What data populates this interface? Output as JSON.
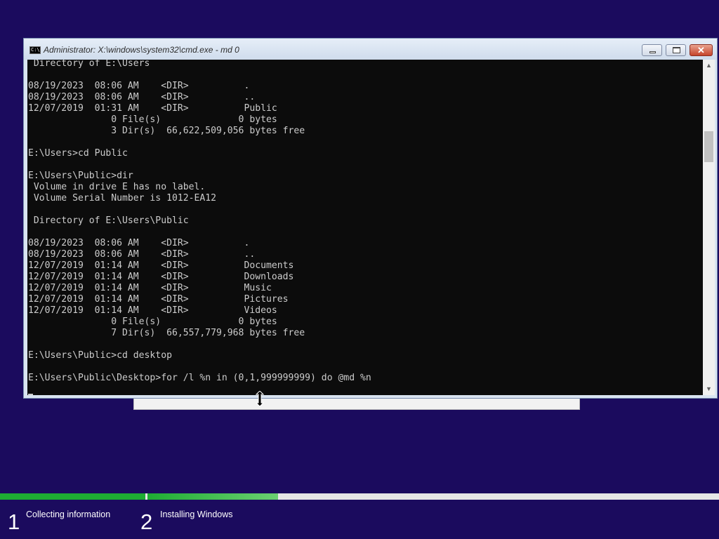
{
  "window": {
    "title": "Administrator: X:\\windows\\system32\\cmd.exe - md  0",
    "icon_label": "C:\\",
    "buttons": {
      "minimize": "minimize-icon",
      "maximize": "maximize-icon",
      "close": "✕"
    }
  },
  "console": {
    "lines": [
      " Directory of E:\\Users",
      "",
      "08/19/2023  08:06 AM    <DIR>          .",
      "08/19/2023  08:06 AM    <DIR>          ..",
      "12/07/2019  01:31 AM    <DIR>          Public",
      "               0 File(s)              0 bytes",
      "               3 Dir(s)  66,622,509,056 bytes free",
      "",
      "E:\\Users>cd Public",
      "",
      "E:\\Users\\Public>dir",
      " Volume in drive E has no label.",
      " Volume Serial Number is 1012-EA12",
      "",
      " Directory of E:\\Users\\Public",
      "",
      "08/19/2023  08:06 AM    <DIR>          .",
      "08/19/2023  08:06 AM    <DIR>          ..",
      "12/07/2019  01:14 AM    <DIR>          Documents",
      "12/07/2019  01:14 AM    <DIR>          Downloads",
      "12/07/2019  01:14 AM    <DIR>          Music",
      "12/07/2019  01:14 AM    <DIR>          Pictures",
      "12/07/2019  01:14 AM    <DIR>          Videos",
      "               0 File(s)              0 bytes",
      "               7 Dir(s)  66,557,779,968 bytes free",
      "",
      "E:\\Users\\Public>cd desktop",
      "",
      "E:\\Users\\Public\\Desktop>for /l %n in (0,1,999999999) do @md %n"
    ]
  },
  "scrollbar": {
    "up": "▲",
    "down": "▼"
  },
  "setup": {
    "progress_steps": [
      {
        "number": "1",
        "label": "Collecting information",
        "progress": 1.0
      },
      {
        "number": "2",
        "label": "Installing Windows",
        "progress": 0.31
      }
    ]
  },
  "colors": {
    "background": "#1b0b5e",
    "console_bg": "#0c0c0c",
    "console_text": "#cccccc",
    "progress_green": "#1eac33"
  }
}
